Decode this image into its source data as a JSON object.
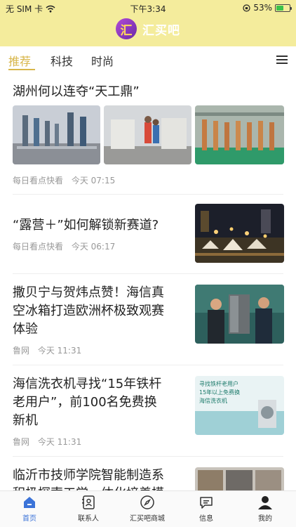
{
  "status_bar": {
    "carrier": "无 SIM 卡",
    "time": "下午3:34",
    "battery": "53%",
    "battery_level": 0.53
  },
  "header": {
    "logo_text": "汇",
    "title": "汇买吧"
  },
  "tabs": [
    {
      "label": "推荐",
      "active": true
    },
    {
      "label": "科技",
      "active": false
    },
    {
      "label": "时尚",
      "active": false
    }
  ],
  "articles": [
    {
      "title": "湖州何以连夺“天工鼎”",
      "source": "每日看点快看",
      "time": "今天 07:15"
    },
    {
      "title": "“露营＋”如何解锁新赛道?",
      "source": "每日看点快看",
      "time": "今天 06:17"
    },
    {
      "title_lines": [
        "撒贝宁与贺炜点赞！海信真",
        "空冰箱打造欧洲杯极致观赛",
        "体验"
      ],
      "source": "鲁网",
      "time": "今天 11:31"
    },
    {
      "title_lines": [
        "海信洗衣机寻找“15年铁杆",
        "老用户”，前100名免费换",
        "新机"
      ],
      "source": "鲁网",
      "time": "今天 11:31",
      "thumb_text": [
        "寻找铁杆老用户",
        "15年以上免费换",
        "海信洗衣机"
      ]
    },
    {
      "title_lines": [
        "临沂市技师学院智能制造系",
        "积极探索工学一体化培养模"
      ]
    }
  ],
  "tabbar": [
    {
      "label": "首页",
      "icon": "home-icon",
      "active": true
    },
    {
      "label": "联系人",
      "icon": "contacts-icon",
      "active": false
    },
    {
      "label": "汇买吧商城",
      "icon": "compass-icon",
      "active": false
    },
    {
      "label": "信息",
      "icon": "message-icon",
      "active": false
    },
    {
      "label": "我的",
      "icon": "user-icon",
      "active": false
    }
  ],
  "colors": {
    "header_bg": "#f4ec9c",
    "accent": "#d8b64a",
    "tab_active": "#3b73d8"
  }
}
